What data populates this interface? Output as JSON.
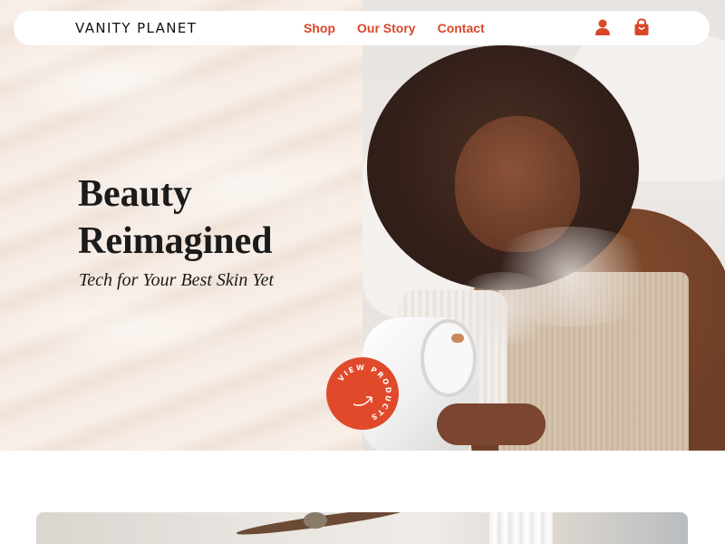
{
  "brand": {
    "logo": "VANITY PLANET",
    "accent": "#e04a2b"
  },
  "nav": {
    "links": [
      "Shop",
      "Our Story",
      "Contact"
    ],
    "icons": [
      "account-icon",
      "shopping-bag-icon"
    ]
  },
  "hero": {
    "title_line1": "Beauty",
    "title_line2": "Reimagined",
    "subtitle": "Tech for Your Best Skin Yet",
    "badge_text": "VIEW PRODUCTS"
  }
}
